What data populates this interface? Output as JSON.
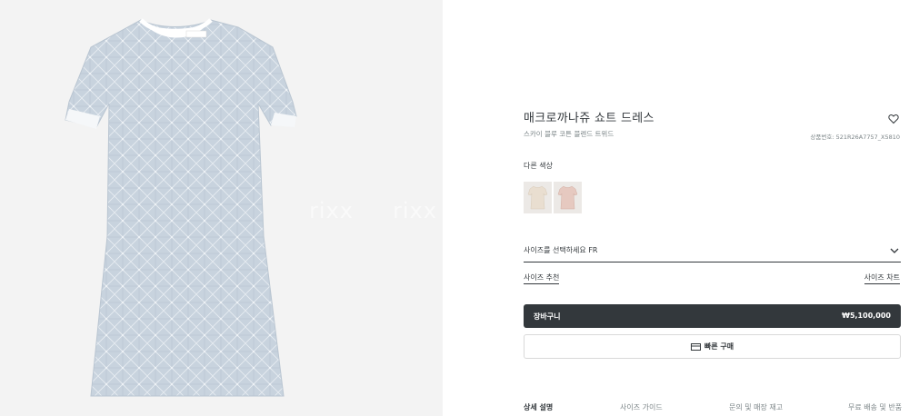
{
  "watermark": [
    "rixx",
    "rixx",
    "rixx",
    "rixx"
  ],
  "product": {
    "title": "매크로까나쥬 쇼트 드레스",
    "subtitle": "스카이 블루 코튼 블렌드 트위드",
    "reference": "상품번호: 521R26A7757_X5810",
    "wishlist_icon": "heart-outline-icon"
  },
  "colors": {
    "label": "다른 색상",
    "swatches": [
      {
        "name": "beige-dress",
        "color": "#e9ded0"
      },
      {
        "name": "pink-dress",
        "color": "#e6c9c0"
      }
    ]
  },
  "size": {
    "select_label": "사이즈를 선택하세요 FR",
    "recommend": "사이즈 추천",
    "chart": "사이즈 차트"
  },
  "cart": {
    "label": "장바구니",
    "price": "₩5,100,000"
  },
  "quick_buy": {
    "label": "빠른 구매",
    "icon": "card-icon"
  },
  "tabs": [
    {
      "label": "상세 설명",
      "active": true
    },
    {
      "label": "사이즈 가이드",
      "active": false
    },
    {
      "label": "문의 및 매장 재고",
      "active": false
    },
    {
      "label": "무료 배송 및 반품",
      "active": false
    }
  ],
  "colors_theme": {
    "dark": "#33383c",
    "muted": "#7b8487",
    "image_bg": "#f3f3f3",
    "dress": "#c9d4de"
  }
}
